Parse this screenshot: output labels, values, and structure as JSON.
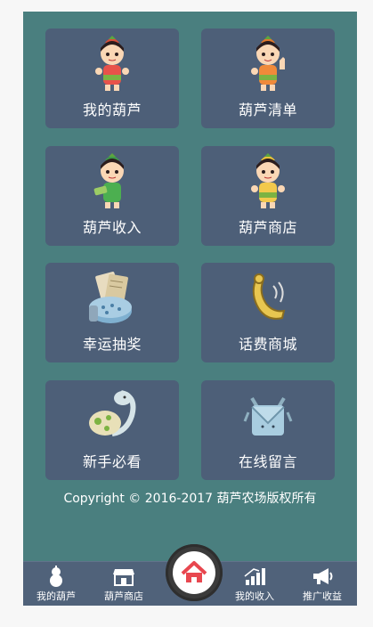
{
  "menu": [
    {
      "label": "我的葫芦",
      "icon": "gourd-boy-icon"
    },
    {
      "label": "葫芦清单",
      "icon": "gourd-boy-thumbs-icon"
    },
    {
      "label": "葫芦收入",
      "icon": "gourd-boy-money-icon"
    },
    {
      "label": "葫芦商店",
      "icon": "gourd-boy-shop-icon"
    },
    {
      "label": "幸运抽奖",
      "icon": "lottery-icon"
    },
    {
      "label": "话费商城",
      "icon": "phone-icon"
    },
    {
      "label": "新手必看",
      "icon": "guide-dragon-icon"
    },
    {
      "label": "在线留言",
      "icon": "message-envelope-icon"
    }
  ],
  "copyright": "Copyright © 2016-2017 葫芦农场版权所有",
  "tabbar": {
    "items": [
      {
        "label": "我的葫芦",
        "icon": "gourd-icon"
      },
      {
        "label": "葫芦商店",
        "icon": "shop-icon"
      },
      {
        "label": "我的收入",
        "icon": "bar-chart-icon"
      },
      {
        "label": "推广收益",
        "icon": "megaphone-icon"
      }
    ],
    "home_icon": "home-icon"
  },
  "colors": {
    "background": "#4a7f7f",
    "tile": "#4d5f78",
    "tabbar": "#50627a",
    "home_accent": "#e8474f"
  }
}
